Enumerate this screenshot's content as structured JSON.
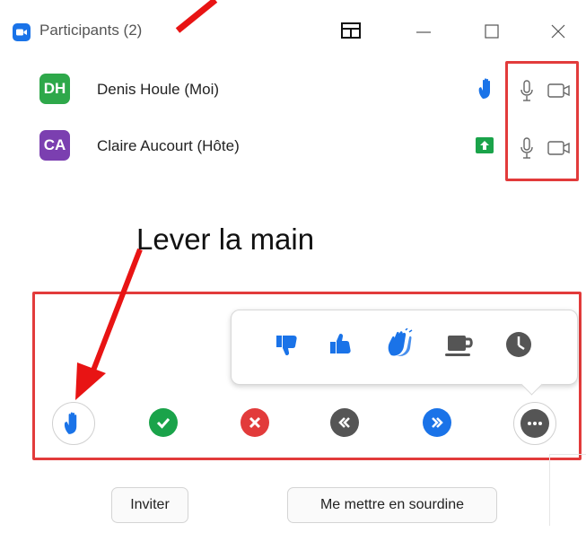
{
  "window": {
    "title": "Participants (2)",
    "controls": {
      "layout_icon": "split-layout-icon",
      "minimize_icon": "minimize-icon",
      "maximize_icon": "maximize-icon",
      "close_icon": "close-icon"
    }
  },
  "participants": [
    {
      "initials": "DH",
      "name": "Denis Houle (Moi)",
      "avatar_color": "#2ea84a",
      "status_icon": "raised-hand-icon",
      "status_color": "#1a73e8"
    },
    {
      "initials": "CA",
      "name": "Claire Aucourt (Hôte)",
      "avatar_color": "#7b3fb0",
      "status_icon": "share-screen-icon",
      "status_color": "#1aa34a"
    }
  ],
  "annotation": {
    "text": "Lever la main"
  },
  "reactions": [
    "thumbs-down-icon",
    "thumbs-up-icon",
    "clap-icon",
    "coffee-icon",
    "clock-icon"
  ],
  "feedback_bar": [
    "raise-hand-icon",
    "yes-check-icon",
    "no-x-icon",
    "slower-icon",
    "faster-icon",
    "more-icon"
  ],
  "footer": {
    "invite_label": "Inviter",
    "mute_me_label": "Me mettre en sourdine"
  },
  "colors": {
    "accent": "#1a73e8",
    "red_box": "#e23b3b",
    "green": "#1aa34a",
    "red": "#e23b3b",
    "grey": "#555555"
  }
}
